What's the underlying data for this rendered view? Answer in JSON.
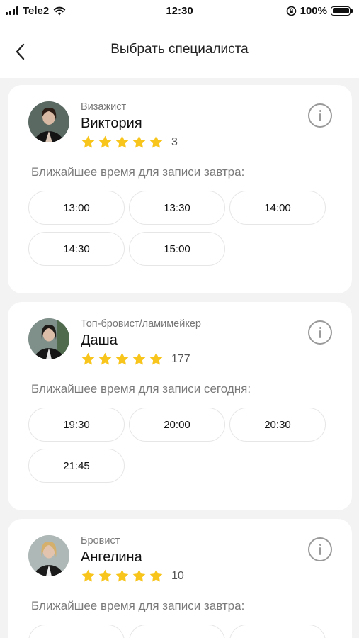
{
  "status_bar": {
    "carrier": "Tele2",
    "time": "12:30",
    "battery": "100%"
  },
  "header": {
    "title": "Выбрать специалиста"
  },
  "colors": {
    "star": "#F8C51C",
    "background": "#F3F3F3",
    "card": "#FFFFFF"
  },
  "specialists": [
    {
      "role": "Визажист",
      "name": "Виктория",
      "rating_count": "3",
      "slots_label": "Ближайшее время для записи завтра:",
      "slots": [
        "13:00",
        "13:30",
        "14:00",
        "14:30",
        "15:00"
      ]
    },
    {
      "role": "Топ-бровист/ламимейкер",
      "name": "Даша",
      "rating_count": "177",
      "slots_label": "Ближайшее время для записи сегодня:",
      "slots": [
        "19:30",
        "20:00",
        "20:30",
        "21:45"
      ]
    },
    {
      "role": "Бровист",
      "name": "Ангелина",
      "rating_count": "10",
      "slots_label": "Ближайшее время для записи завтра:",
      "slots": []
    }
  ]
}
